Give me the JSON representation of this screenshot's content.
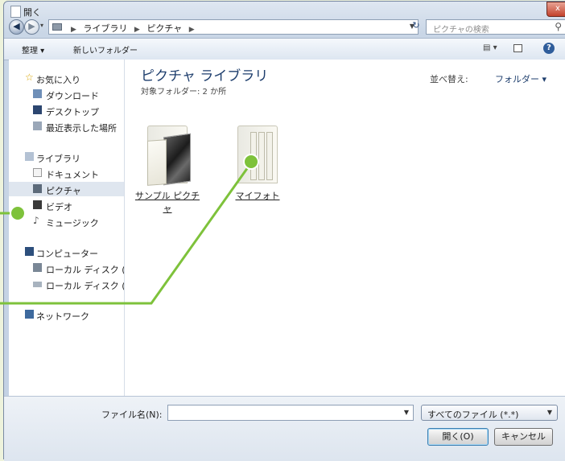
{
  "window": {
    "title": "開く",
    "close_label": "x"
  },
  "address": {
    "crumbs": [
      "ライブラリ",
      "ピクチャ"
    ],
    "search_placeholder": "ピクチャの検索"
  },
  "toolbar": {
    "organize_label": "整理 ▾",
    "new_folder_label": "新しいフォルダー"
  },
  "sidebar": {
    "items": [
      {
        "label": "お気に入り",
        "icon": "star-icon"
      },
      {
        "label": "ダウンロード",
        "icon": "download-folder-icon"
      },
      {
        "label": "デスクトップ",
        "icon": "desktop-icon"
      },
      {
        "label": "最近表示した場所",
        "icon": "recent-places-icon"
      },
      {
        "label": "ライブラリ",
        "icon": "library-icon"
      },
      {
        "label": "ドキュメント",
        "icon": "document-icon"
      },
      {
        "label": "ピクチャ",
        "icon": "picture-icon"
      },
      {
        "label": "ビデオ",
        "icon": "video-icon"
      },
      {
        "label": "ミュージック",
        "icon": "music-icon"
      },
      {
        "label": "コンピューター",
        "icon": "computer-icon"
      },
      {
        "label": "ローカル ディスク (",
        "icon": "drive-icon"
      },
      {
        "label": "ローカル ディスク (",
        "icon": "drive-icon"
      },
      {
        "label": "ネットワーク",
        "icon": "network-icon"
      }
    ],
    "selected_index": 6
  },
  "main": {
    "title": "ピクチャ ライブラリ",
    "subtitle": "対象フォルダー: 2 か所",
    "sort_label": "並べ替え:",
    "sort_value": "フォルダー ▾",
    "folders": [
      {
        "name": "サンプル ピクチャ"
      },
      {
        "name": "マイフォト"
      }
    ]
  },
  "bottom": {
    "filename_label": "ファイル名(N):",
    "filename_value": "",
    "filetype_value": "すべてのファイル (*.*)",
    "open_label": "開く(O)",
    "cancel_label": "キャンセル"
  },
  "colors": {
    "callout": "#7ec23b",
    "background": "#eef3dc"
  }
}
